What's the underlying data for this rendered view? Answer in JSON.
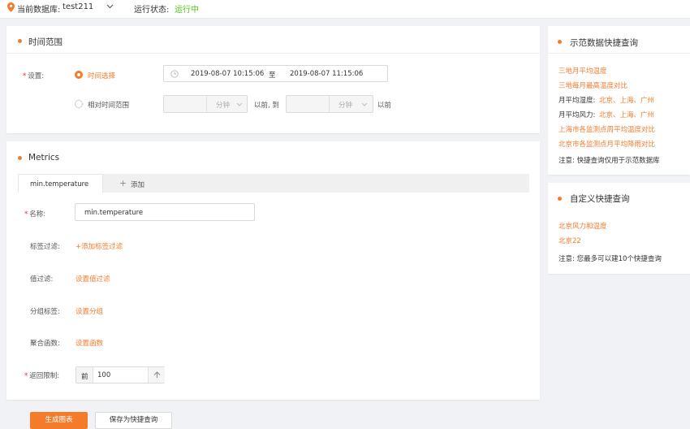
{
  "topbar": {
    "db_label": "当前数据库:",
    "db_value": "test211",
    "status_label": "运行状态:",
    "status_value": "运行中"
  },
  "time_range": {
    "title": "时间范围",
    "setting_label": "设置:",
    "option_select": "时间选择",
    "start": "2019-08-07 10:15:06",
    "to": "至",
    "end": "2019-08-07 11:15:06",
    "option_relative": "相对时间范围",
    "unit1": "分钟",
    "before_to": "以前, 到",
    "unit2": "分钟",
    "before": "以前"
  },
  "metrics": {
    "title": "Metrics",
    "tab_label": "min.temperature",
    "add_label": "添加",
    "name_label": "名称:",
    "name_value": "min.temperature",
    "tag_filter_label": "标签过滤:",
    "tag_filter_link": "+添加标签过滤",
    "value_filter_label": "值过滤:",
    "value_filter_link": "设置值过滤",
    "group_label": "分组标签:",
    "group_link": "设置分组",
    "agg_label": "聚合函数:",
    "agg_link": "设置函数",
    "limit_label": "返回限制:",
    "limit_prefix": "前",
    "limit_value": "100"
  },
  "buttons": {
    "generate": "生成图表",
    "save_quick": "保存为快捷查询"
  },
  "demo_queries": {
    "title": "示范数据快捷查询",
    "item1": "三地月平均温度",
    "item2": "三地每月最高温度对比",
    "row3_label": "月平均湿度:",
    "row3_links": "北京、上海、广州",
    "row4_label": "月平均风力:",
    "row4_links": "北京、上海、广州",
    "item5": "上海市各监测点周平均温度对比",
    "item6": "北京市各监测点月平均降雨对比",
    "note": "注意: 快捷查询仅用于示范数据库"
  },
  "custom_queries": {
    "title": "自定义快捷查询",
    "item1": "北京风力和温度",
    "item2": "北京22",
    "note": "注意: 您最多可以建10个快捷查询"
  },
  "colors": {
    "accent": "#f47b2a",
    "status_green": "#52c41a"
  }
}
